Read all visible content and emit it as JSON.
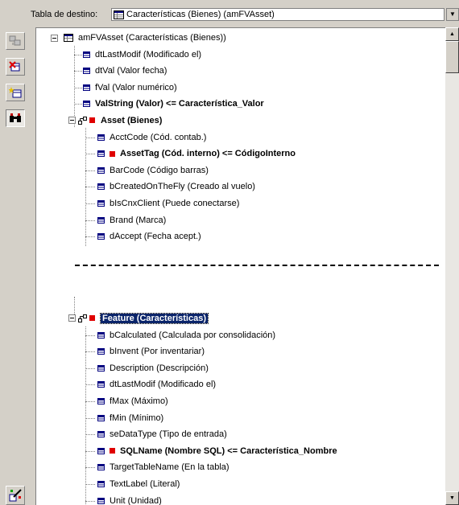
{
  "header": {
    "dest_label": "Tabla de destino:",
    "dest_value": "Características (Bienes) (amFVAsset)"
  },
  "toolbar": {
    "buttons": [
      {
        "icon": "copy-fields-icon"
      },
      {
        "icon": "delete-field-icon"
      },
      {
        "icon": "add-field-icon"
      },
      {
        "icon": "binoculars-icon"
      },
      {
        "icon": "wizard-icon"
      }
    ]
  },
  "tree": {
    "root": "amFVAsset (Características (Bienes))",
    "root_fields": [
      {
        "label": "dtLastModif (Modificado el)",
        "bold": false
      },
      {
        "label": "dtVal (Valor fecha)",
        "bold": false
      },
      {
        "label": "fVal (Valor numérico)",
        "bold": false
      },
      {
        "label": "ValString (Valor)  <=  Característica_Valor",
        "bold": true
      }
    ],
    "asset_link": "Asset (Bienes)",
    "asset_fields": [
      {
        "label": "AcctCode (Cód. contab.)",
        "bold": false,
        "key": false
      },
      {
        "label": "AssetTag (Cód. interno)  <=  CódigoInterno",
        "bold": true,
        "key": true
      },
      {
        "label": "BarCode (Código barras)",
        "bold": false,
        "key": false
      },
      {
        "label": "bCreatedOnTheFly (Creado al vuelo)",
        "bold": false,
        "key": false
      },
      {
        "label": "bIsCnxClient (Puede conectarse)",
        "bold": false,
        "key": false
      },
      {
        "label": "Brand (Marca)",
        "bold": false,
        "key": false
      },
      {
        "label": "dAccept (Fecha acept.)",
        "bold": false,
        "key": false
      }
    ],
    "feature_link": "Feature (Características)",
    "feature_fields": [
      {
        "label": "bCalculated (Calculada por consolidación)",
        "bold": false,
        "key": false
      },
      {
        "label": "bInvent (Por inventariar)",
        "bold": false,
        "key": false
      },
      {
        "label": "Description (Descripción)",
        "bold": false,
        "key": false
      },
      {
        "label": "dtLastModif (Modificado el)",
        "bold": false,
        "key": false
      },
      {
        "label": "fMax (Máximo)",
        "bold": false,
        "key": false
      },
      {
        "label": "fMin (Mínimo)",
        "bold": false,
        "key": false
      },
      {
        "label": "seDataType (Tipo de entrada)",
        "bold": false,
        "key": false
      },
      {
        "label": "SQLName (Nombre SQL)  <=  Característica_Nombre",
        "bold": true,
        "key": true
      },
      {
        "label": "TargetTableName (En la tabla)",
        "bold": false,
        "key": false
      },
      {
        "label": "TextLabel (Literal)",
        "bold": false,
        "key": false
      },
      {
        "label": "Unit (Unidad)",
        "bold": false,
        "key": false
      }
    ]
  },
  "colors": {
    "selection": "#0a246a",
    "key_marker": "#e00000",
    "panel_bg": "#d4d0c8"
  }
}
